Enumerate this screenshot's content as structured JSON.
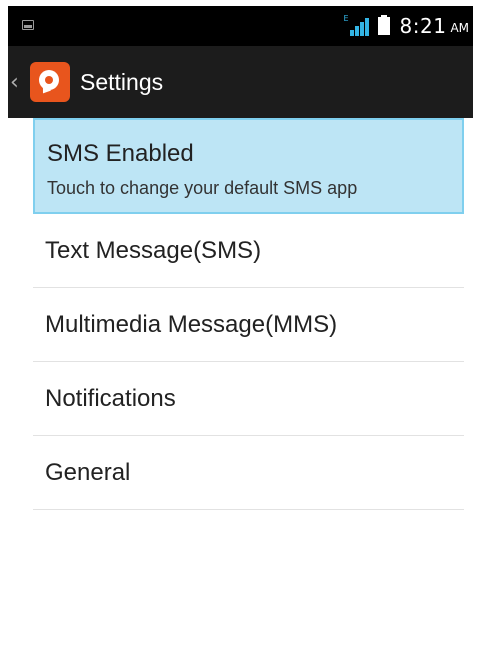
{
  "status_bar": {
    "time": "8:21",
    "ampm": "AM",
    "network_label": "E"
  },
  "action_bar": {
    "title": "Settings"
  },
  "settings": [
    {
      "label": "SMS Enabled",
      "summary": "Touch to change your default SMS app"
    },
    {
      "label": "Text Message(SMS)"
    },
    {
      "label": "Multimedia Message(MMS)"
    },
    {
      "label": "Notifications"
    },
    {
      "label": "General"
    }
  ],
  "colors": {
    "accent": "#33b5e5",
    "selection": "#bde5f5",
    "app_icon": "#e8551d"
  }
}
